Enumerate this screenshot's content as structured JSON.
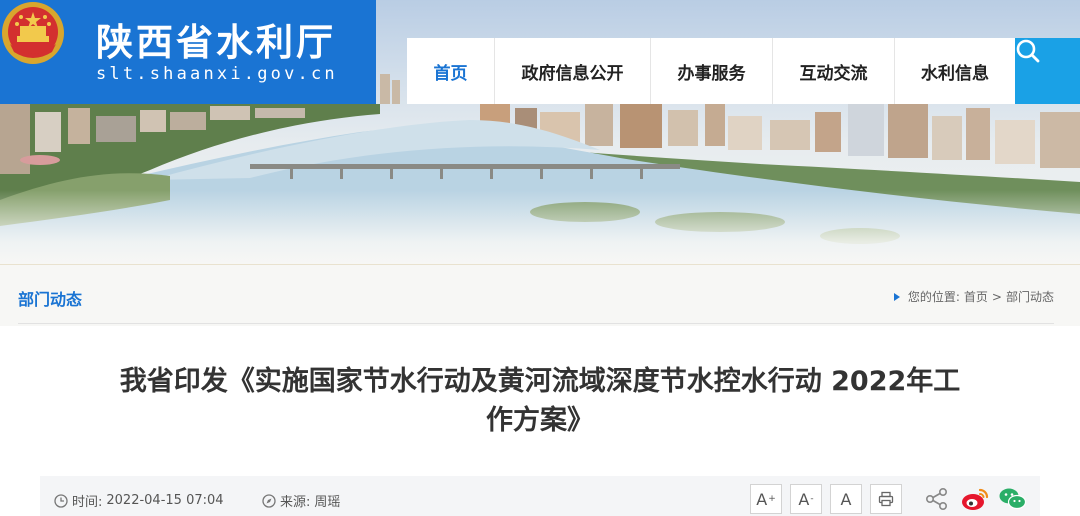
{
  "site": {
    "title": "陕西省水利厅",
    "domain": "slt.shaanxi.gov.cn"
  },
  "nav": {
    "items": [
      {
        "label": "首页",
        "active": true
      },
      {
        "label": "政府信息公开",
        "active": false
      },
      {
        "label": "办事服务",
        "active": false
      },
      {
        "label": "互动交流",
        "active": false
      },
      {
        "label": "水利信息",
        "active": false
      }
    ],
    "search_icon": "search-icon"
  },
  "section": {
    "title": "部门动态",
    "breadcrumb_prefix": "您的位置:",
    "breadcrumb_home": "首页",
    "breadcrumb_sep": ">",
    "breadcrumb_current": "部门动态"
  },
  "article": {
    "title_line1": "我省印发《实施国家节水行动及黄河流域深度节水控水行动 2022年工",
    "title_line2": "作方案》",
    "time_label": "时间:",
    "time_value": "2022-04-15 07:04",
    "source_label": "来源:",
    "source_value": "周瑶"
  },
  "toolbar": {
    "font_large": "A",
    "font_large_mark": "+",
    "font_small": "A",
    "font_small_mark": "-",
    "font_default": "A",
    "icons": [
      "print-icon",
      "share-icon",
      "weibo-icon",
      "wechat-icon"
    ]
  },
  "colors": {
    "brand_blue": "#1a74d3",
    "search_blue": "#1aa1e6",
    "weibo_red": "#e6162d",
    "wechat_green": "#2aae67"
  }
}
